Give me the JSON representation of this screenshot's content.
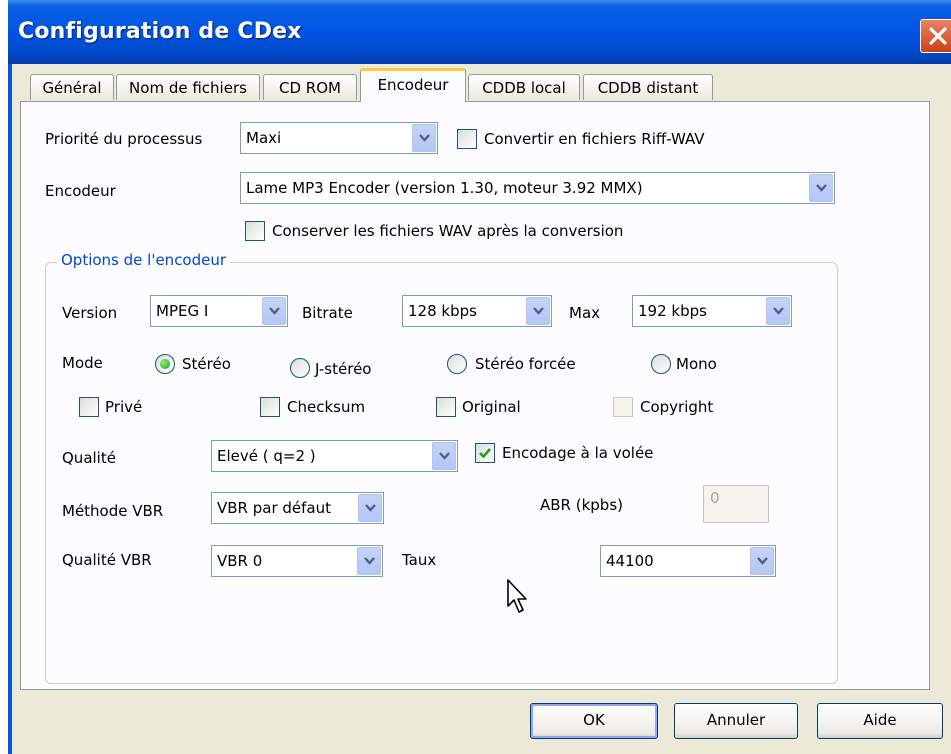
{
  "window": {
    "title": "Configuration de CDex"
  },
  "tabs": [
    {
      "label": "Général"
    },
    {
      "label": "Nom de fichiers"
    },
    {
      "label": "CD ROM"
    },
    {
      "label": "Encodeur",
      "active": true
    },
    {
      "label": "CDDB local"
    },
    {
      "label": "CDDB distant"
    }
  ],
  "general": {
    "priority_label": "Priorité du processus",
    "priority_value": "Maxi",
    "convert_riff_label": "Convertir en fichiers Riff-WAV",
    "convert_riff_checked": false,
    "encoder_label": "Encodeur",
    "encoder_value": "Lame MP3 Encoder (version 1.30, moteur 3.92 MMX)",
    "keep_wav_label": "Conserver les fichiers WAV après la conversion",
    "keep_wav_checked": false
  },
  "options": {
    "group_title": "Options de l'encodeur",
    "version_label": "Version",
    "version_value": "MPEG I",
    "bitrate_label": "Bitrate",
    "bitrate_value": "128 kbps",
    "max_label": "Max",
    "max_value": "192 kbps",
    "mode_label": "Mode",
    "modes": [
      {
        "label": "Stéréo",
        "selected": true
      },
      {
        "label": "J-stéréo",
        "selected": false
      },
      {
        "label": "Stéréo forcée",
        "selected": false
      },
      {
        "label": "Mono",
        "selected": false
      }
    ],
    "flags": [
      {
        "label": "Privé",
        "checked": false,
        "enabled": true
      },
      {
        "label": "Checksum",
        "checked": false,
        "enabled": true
      },
      {
        "label": "Original",
        "checked": false,
        "enabled": true
      },
      {
        "label": "Copyright",
        "checked": false,
        "enabled": false
      }
    ],
    "quality_label": "Qualité",
    "quality_value": "Elevé ( q=2 )",
    "on_the_fly_label": "Encodage à la volée",
    "on_the_fly_checked": true,
    "vbr_method_label": "Méthode VBR",
    "vbr_method_value": "VBR par défaut",
    "abr_label": "ABR (kpbs)",
    "abr_value": "0",
    "vbr_quality_label": "Qualité VBR",
    "vbr_quality_value": "VBR 0",
    "rate_label": "Taux",
    "rate_value": "44100"
  },
  "buttons": {
    "ok": "OK",
    "cancel": "Annuler",
    "help": "Aide"
  },
  "colors": {
    "titlebar": "#0054e3",
    "accent_tab": "#ffc83c",
    "group_title": "#0046d5",
    "check_mark": "#21a121"
  }
}
